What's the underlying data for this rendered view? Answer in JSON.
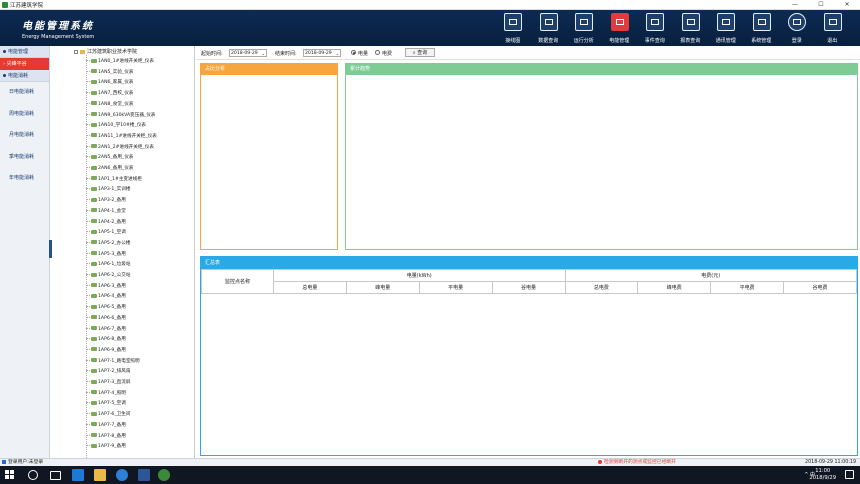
{
  "window": {
    "title": "江苏建筑学院",
    "buttons": [
      "—",
      "☐",
      "✕"
    ]
  },
  "header": {
    "logo_cn": "电能管理系统",
    "logo_en": "Energy Management System"
  },
  "nav": [
    {
      "label": "接线图",
      "icon": "wiring-diagram-icon"
    },
    {
      "label": "数据查询",
      "icon": "data-query-icon"
    },
    {
      "label": "运行分析",
      "icon": "run-analysis-icon"
    },
    {
      "label": "电能管理",
      "icon": "energy-management-icon",
      "active": true
    },
    {
      "label": "事件查询",
      "icon": "event-query-icon"
    },
    {
      "label": "报表查询",
      "icon": "report-query-icon"
    },
    {
      "label": "通讯管理",
      "icon": "communication-icon"
    },
    {
      "label": "系统管理",
      "icon": "system-management-icon"
    },
    {
      "label": "登录",
      "icon": "user-icon"
    },
    {
      "label": "退出",
      "icon": "exit-icon"
    }
  ],
  "sidebar": {
    "section1": "电能管理",
    "active": "尖峰平谷",
    "section2": "电能消耗",
    "items": [
      "日电能消耗",
      "周电能消耗",
      "月电能消耗",
      "季电能消耗",
      "年电能消耗"
    ]
  },
  "tree": {
    "root": "江苏建筑职业技术学院",
    "leaves": [
      "1AN0_1#进线开关柜_仪表",
      "1AN5_实验_仪表",
      "1AN6_家属_仪表",
      "1AN7_西校_仪表",
      "1AN8_食堂_仪表",
      "1AN9_630kVA变压器_仪表",
      "1AN10_学10#楼_仪表",
      "1AN11_1#进线开关柜_仪表",
      "2AN1_2#进线开关柜_仪表",
      "2AN5_备用_仪表",
      "2AN6_备用_仪表",
      "1AP1_1#主变进线柜",
      "1AP3-1_实训楼",
      "1AP3-2_备用",
      "1AP4-1_会堂",
      "1AP4-2_备用",
      "1AP5-1_空调",
      "1AP5-2_办公楼",
      "1AP5-3_备用",
      "1AP6-1_垃圾站",
      "1AP6-2_公交站",
      "1AP6-3_备用",
      "1AP6-4_备用",
      "1AP6-5_备用",
      "1AP6-6_备用",
      "1AP6-7_备用",
      "1AP6-8_备用",
      "1AP6-9_备用",
      "1AP7-1_路电室照明",
      "1AP7-2_排风扇",
      "1AP7-3_直流屏",
      "1AP7-4_照明",
      "1AP7-5_空调",
      "1AP7-6_卫生间",
      "1AP7-7_备用",
      "1AP7-8_备用",
      "1AP7-9_备用"
    ]
  },
  "filter": {
    "start_label": "起始时间:",
    "start_value": "2018-09-29",
    "end_label": "结束时间:",
    "end_value": "2018-09-29",
    "radio_power": "电量",
    "radio_fee": "电费",
    "query": "查询"
  },
  "panels": {
    "ratio": "占比分析",
    "trend": "累计趋势",
    "summary": "汇总表"
  },
  "table": {
    "col_name": "监控点名称",
    "group_power": "电量(kWh)",
    "group_fee": "电费(元)",
    "power_cols": [
      "总电量",
      "峰电量",
      "平电量",
      "谷电量"
    ],
    "fee_cols": [
      "总电费",
      "峰电费",
      "平电费",
      "谷电费"
    ]
  },
  "status": {
    "user": "登录用户:未登录",
    "alert": "检测到断开的测点或监控已经断开",
    "clock": "2018-09-29 11:00:19"
  },
  "taskbar": {
    "time": "11:00",
    "date": "2018/9/29",
    "tray": "^ 中"
  }
}
